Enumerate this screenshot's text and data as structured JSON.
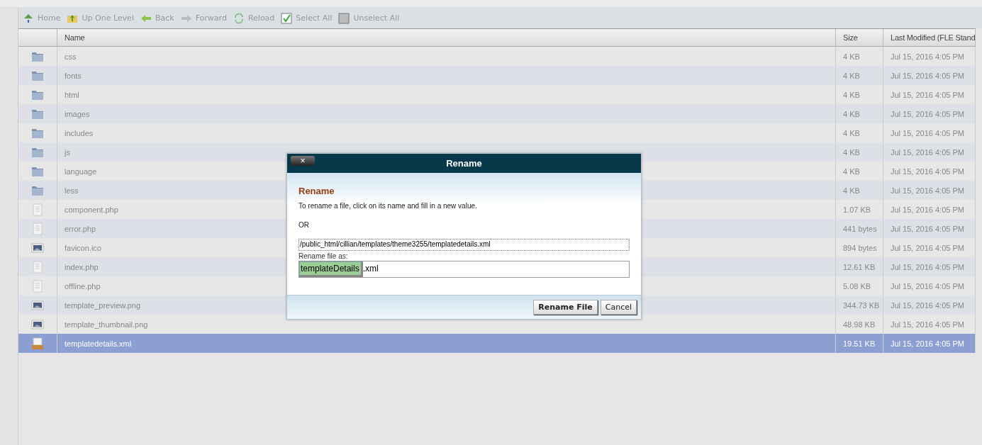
{
  "toolbar": [
    {
      "kind": "home",
      "label": "Home"
    },
    {
      "kind": "up",
      "label": "Up One Level"
    },
    {
      "kind": "back",
      "label": "Back"
    },
    {
      "kind": "forward",
      "label": "Forward"
    },
    {
      "kind": "reload",
      "label": "Reload"
    },
    {
      "kind": "select",
      "label": "Select All"
    },
    {
      "kind": "unselect",
      "label": "Unselect All"
    }
  ],
  "table": {
    "columns": [
      "Name",
      "Size",
      "Last Modified (FLE Stand"
    ],
    "rows": [
      {
        "kind": "folder",
        "name": "css",
        "size": "4 KB",
        "modified": "Jul 15, 2016 4:05 PM",
        "selected": false
      },
      {
        "kind": "folder",
        "name": "fonts",
        "size": "4 KB",
        "modified": "Jul 15, 2016 4:05 PM",
        "selected": false
      },
      {
        "kind": "folder",
        "name": "html",
        "size": "4 KB",
        "modified": "Jul 15, 2016 4:05 PM",
        "selected": false
      },
      {
        "kind": "folder",
        "name": "images",
        "size": "4 KB",
        "modified": "Jul 15, 2016 4:05 PM",
        "selected": false
      },
      {
        "kind": "folder",
        "name": "includes",
        "size": "4 KB",
        "modified": "Jul 15, 2016 4:05 PM",
        "selected": false
      },
      {
        "kind": "folder",
        "name": "js",
        "size": "4 KB",
        "modified": "Jul 15, 2016 4:05 PM",
        "selected": false
      },
      {
        "kind": "folder",
        "name": "language",
        "size": "4 KB",
        "modified": "Jul 15, 2016 4:05 PM",
        "selected": false
      },
      {
        "kind": "folder",
        "name": "less",
        "size": "4 KB",
        "modified": "Jul 15, 2016 4:05 PM",
        "selected": false
      },
      {
        "kind": "document",
        "name": "component.php",
        "size": "1.07 KB",
        "modified": "Jul 15, 2016 4:05 PM",
        "selected": false
      },
      {
        "kind": "document",
        "name": "error.php",
        "size": "441 bytes",
        "modified": "Jul 15, 2016 4:05 PM",
        "selected": false
      },
      {
        "kind": "image",
        "name": "favicon.ico",
        "size": "894 bytes",
        "modified": "Jul 15, 2016 4:05 PM",
        "selected": false
      },
      {
        "kind": "document",
        "name": "index.php",
        "size": "12.61 KB",
        "modified": "Jul 15, 2016 4:05 PM",
        "selected": false
      },
      {
        "kind": "document",
        "name": "offline.php",
        "size": "5.08 KB",
        "modified": "Jul 15, 2016 4:05 PM",
        "selected": false
      },
      {
        "kind": "image",
        "name": "template_preview.png",
        "size": "344.73 KB",
        "modified": "Jul 15, 2016 4:05 PM",
        "selected": false
      },
      {
        "kind": "image",
        "name": "template_thumbnail.png",
        "size": "48.98 KB",
        "modified": "Jul 15, 2016 4:05 PM",
        "selected": false
      },
      {
        "kind": "xml",
        "name": "templatedetails.xml",
        "size": "19.51 KB",
        "modified": "Jul 15, 2016 4:05 PM",
        "selected": true
      }
    ]
  },
  "dialog": {
    "title": "Rename",
    "close": "×",
    "heading": "Rename",
    "instruction": "To rename a file, click on its name and fill in a new value.",
    "or": "OR",
    "path": "/public_html/cillian/templates/theme3255/templatedetails.xml",
    "rename_label": "Rename file as:",
    "value_selected": "templateDetails",
    "value_rest": ".xml",
    "buttons": [
      "Rename File",
      "Cancel"
    ]
  }
}
